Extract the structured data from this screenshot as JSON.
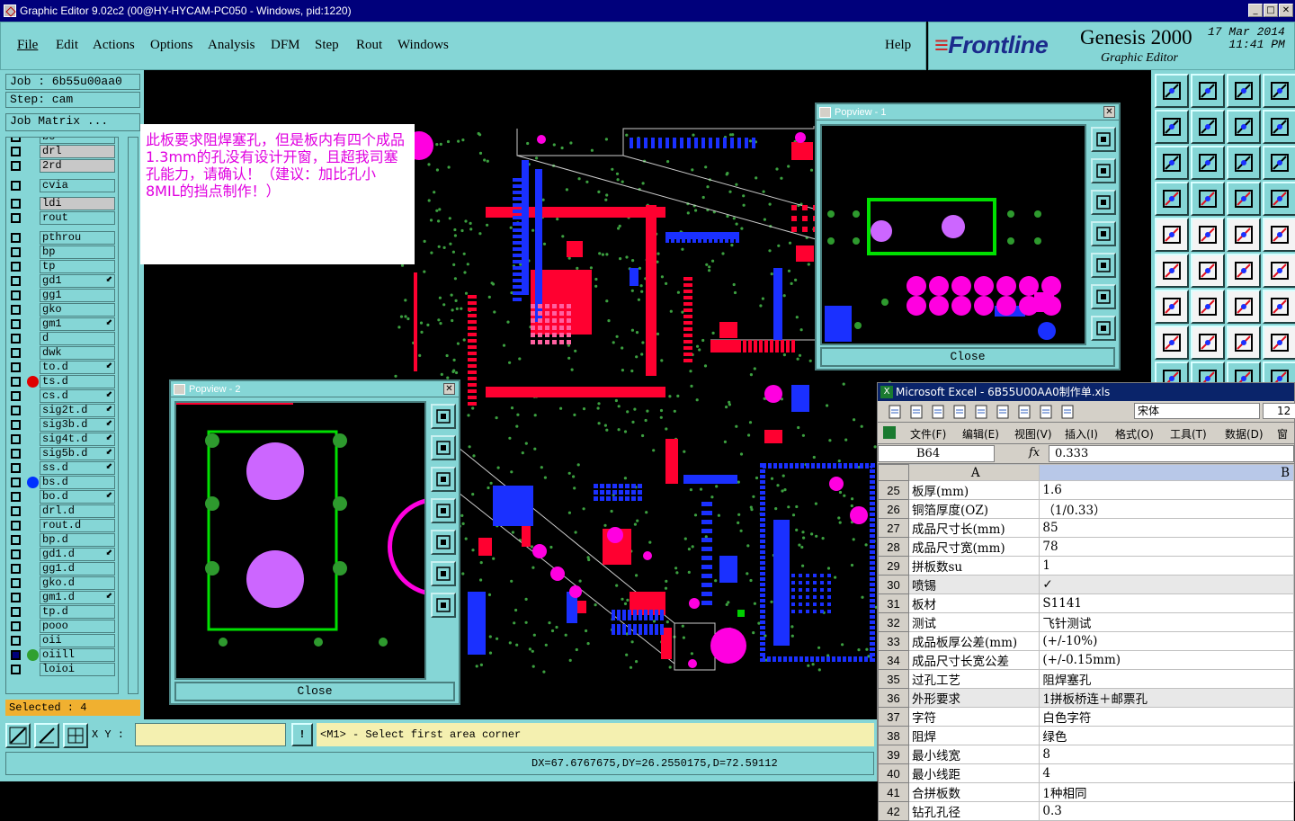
{
  "window": {
    "title": "Graphic Editor 9.02c2 (00@HY-HYCAM-PC050 - Windows, pid:1220)"
  },
  "menu": [
    "File",
    "Edit",
    "Actions",
    "Options",
    "Analysis",
    "DFM",
    "Step",
    "Rout",
    "Windows",
    "Help"
  ],
  "logo": {
    "brand": "Frontline",
    "product": "Genesis 2000",
    "subtitle": "Graphic Editor",
    "date": "17 Mar 2014",
    "time": "11:41 PM"
  },
  "job": {
    "job": "Job : 6b55u00aa0",
    "step": "Step: cam",
    "matrix": "Job Matrix ..."
  },
  "layers": [
    {
      "name": "bo",
      "dot": ""
    },
    {
      "name": "drl",
      "dot": "",
      "sel": true
    },
    {
      "name": "2rd",
      "dot": "",
      "sel": true
    },
    {
      "name": "cvia",
      "dot": ""
    },
    {
      "name": "ldi",
      "dot": "",
      "sel": true
    },
    {
      "name": "rout",
      "dot": ""
    },
    {
      "name": "pthrou",
      "dot": ""
    },
    {
      "name": "bp",
      "dot": ""
    },
    {
      "name": "tp",
      "dot": ""
    },
    {
      "name": "gd1",
      "dot": "",
      "arrow": true
    },
    {
      "name": "gg1",
      "dot": ""
    },
    {
      "name": "gko",
      "dot": ""
    },
    {
      "name": "gm1",
      "dot": "",
      "arrow": true
    },
    {
      "name": "d",
      "dot": ""
    },
    {
      "name": "dwk",
      "dot": ""
    },
    {
      "name": "to.d",
      "dot": "",
      "arrow": true
    },
    {
      "name": "ts.d",
      "dot": "#e00000"
    },
    {
      "name": "cs.d",
      "dot": "",
      "arrow": true
    },
    {
      "name": "sig2t.d",
      "dot": "",
      "arrow": true
    },
    {
      "name": "sig3b.d",
      "dot": "",
      "arrow": true
    },
    {
      "name": "sig4t.d",
      "dot": "",
      "arrow": true
    },
    {
      "name": "sig5b.d",
      "dot": "",
      "arrow": true
    },
    {
      "name": "ss.d",
      "dot": "",
      "arrow": true
    },
    {
      "name": "bs.d",
      "dot": "#0030ff"
    },
    {
      "name": "bo.d",
      "dot": "",
      "arrow": true
    },
    {
      "name": "drl.d",
      "dot": ""
    },
    {
      "name": "rout.d",
      "dot": ""
    },
    {
      "name": "bp.d",
      "dot": ""
    },
    {
      "name": "gd1.d",
      "dot": "",
      "arrow": true
    },
    {
      "name": "gg1.d",
      "dot": ""
    },
    {
      "name": "gko.d",
      "dot": ""
    },
    {
      "name": "gm1.d",
      "dot": "",
      "arrow": true
    },
    {
      "name": "tp.d",
      "dot": ""
    },
    {
      "name": "pooo",
      "dot": ""
    },
    {
      "name": "oii",
      "dot": ""
    },
    {
      "name": "oiill",
      "dot": "#30a030"
    },
    {
      "name": "loioi",
      "dot": ""
    }
  ],
  "selected": "Selected : 4",
  "note": "此板要求阻焊塞孔，但是板内有四个成品1.3mm的孔没有设计开窗，且超我司塞孔能力，请确认！（建议：加比孔小8MIL的挡点制作！）",
  "popview1": {
    "title": "Popview - 1",
    "close": "Close"
  },
  "popview2": {
    "title": "Popview - 2",
    "close": "Close"
  },
  "status": {
    "xy_label": "X Y :",
    "xy_value": "",
    "prompt": "<M1> - Select first area corner",
    "measure": "DX=67.6767675,DY=26.2550175,D=72.59112"
  },
  "excel": {
    "title": "Microsoft Excel - 6B55U00AA0制作单.xls",
    "font": "宋体",
    "size": "12",
    "menus": [
      "文件(F)",
      "编辑(E)",
      "视图(V)",
      "插入(I)",
      "格式(O)",
      "工具(T)",
      "数据(D)",
      "窗口"
    ],
    "cellref": "B64",
    "formula": "0.333",
    "col_a": "A",
    "col_b": "B",
    "rows": [
      [
        "25",
        "板厚(mm)",
        "1.6"
      ],
      [
        "26",
        "铜箔厚度(OZ)",
        "（1/0.33）"
      ],
      [
        "27",
        "成品尺寸长(mm)",
        "85"
      ],
      [
        "28",
        "成品尺寸宽(mm)",
        "78"
      ],
      [
        "29",
        "拼板数su",
        "1"
      ],
      [
        "30",
        "喷锡",
        "✓"
      ],
      [
        "31",
        "板材",
        "S1141"
      ],
      [
        "32",
        "测试",
        "飞针测试"
      ],
      [
        "33",
        "成品板厚公差(mm)",
        "(+/-10%)"
      ],
      [
        "34",
        "成品尺寸长宽公差",
        "(+/-0.15mm)"
      ],
      [
        "35",
        "过孔工艺",
        "阻焊塞孔"
      ],
      [
        "36",
        "外形要求",
        "1拼板桥连＋邮票孔"
      ],
      [
        "37",
        "字符",
        "白色字符"
      ],
      [
        "38",
        "阻焊",
        "绿色"
      ],
      [
        "39",
        "最小线宽",
        "8"
      ],
      [
        "40",
        "最小线距",
        "4"
      ],
      [
        "41",
        "合拼板数",
        "1种相同"
      ],
      [
        "42",
        "钻孔孔径",
        "0.3"
      ]
    ]
  },
  "colors": {
    "panel": "#85d6d6",
    "titlebar": "#00007b",
    "pad_red": "#ff0030",
    "pad_blue": "#1a30ff",
    "pad_magenta": "#ff00e0",
    "highlight_green": "#00d000",
    "selected_bar": "#f0b030"
  }
}
